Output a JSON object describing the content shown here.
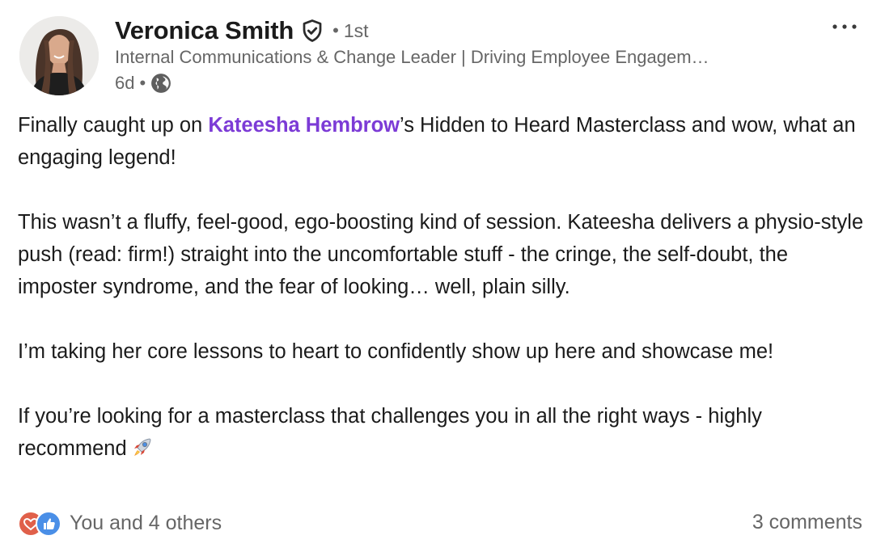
{
  "author": {
    "name": "Veronica Smith",
    "degree": "1st",
    "headline": "Internal Communications & Change Leader | Driving Employee Engagem…",
    "time": "6d",
    "separator": "•",
    "avatar_icon": "profile-photo",
    "verified_icon": "verified-shield-icon",
    "visibility_icon": "globe-icon"
  },
  "menu": {
    "icon": "more-horizontal-icon"
  },
  "post": {
    "p1_before": "Finally caught up on ",
    "mention": "Kateesha Hembrow",
    "p1_after": "’s Hidden to Heard Masterclass and wow, what an engaging legend!",
    "p2": "This wasn’t a fluffy, feel-good, ego-boosting kind of session. Kateesha delivers a physio-style push (read: firm!) straight into the uncomfortable stuff - the cringe, the self-doubt, the imposter syndrome, and the fear of looking… well, plain silly.",
    "p3": "I’m taking her core lessons to heart to confidently show up here and showcase me!",
    "p4": "If you’re looking for a masterclass that challenges you in all the right ways - highly recommend",
    "emoji": "rocket-emoji"
  },
  "social": {
    "reactions_text": "You and 4 others",
    "comments_text": "3 comments",
    "reaction_icons": [
      "heart-reaction-icon",
      "like-reaction-icon"
    ]
  },
  "colors": {
    "mention": "#7c3bd6",
    "secondary_text": "#666666",
    "heart": "#e0604a",
    "like": "#4a8fe7"
  }
}
